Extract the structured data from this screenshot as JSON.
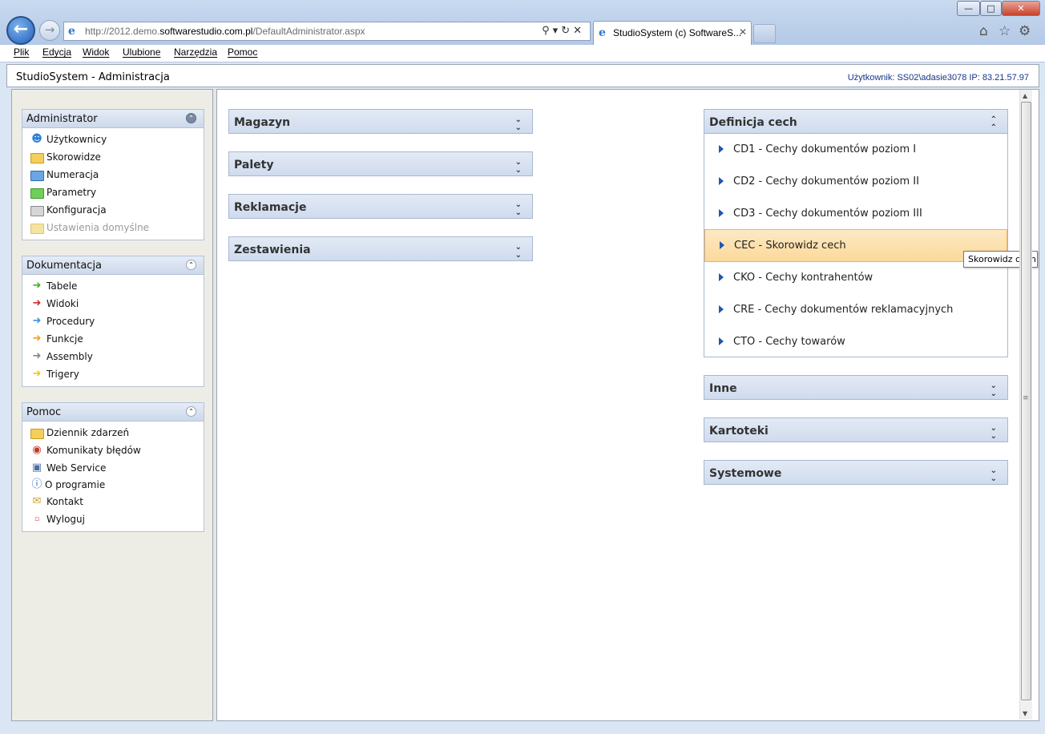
{
  "browser": {
    "url_grey": "http://2012.demo.",
    "url_domain": "softwarestudio.com.pl",
    "url_path": "/DefaultAdministrator.aspx",
    "tab_title": "StudioSystem (c) SoftwareS...",
    "window_controls": [
      "minimize-icon",
      "maximize-icon",
      "close-icon"
    ],
    "toolbar_icons": [
      "home-icon",
      "favorites-star-icon",
      "gear-icon"
    ]
  },
  "menubar": [
    "Plik",
    "Edycja",
    "Widok",
    "Ulubione",
    "Narzędzia",
    "Pomoc"
  ],
  "app": {
    "title": "StudioSystem - Administracja",
    "user_info": "Użytkownik: SS02\\adasie3078 IP: 83.21.57.97"
  },
  "left_panels": [
    {
      "title": "Administrator",
      "items": [
        {
          "label": "Użytkownicy",
          "icon": "users-icon",
          "disabled": false
        },
        {
          "label": "Skorowidze",
          "icon": "folder-yellow-icon",
          "disabled": false
        },
        {
          "label": "Numeracja",
          "icon": "folder-blue-icon",
          "disabled": false
        },
        {
          "label": "Parametry",
          "icon": "folder-green-icon",
          "disabled": false
        },
        {
          "label": "Konfiguracja",
          "icon": "folder-grey-icon",
          "disabled": false
        },
        {
          "label": "Ustawienia domyślne",
          "icon": "folder-yellow-icon",
          "disabled": true
        }
      ]
    },
    {
      "title": "Dokumentacja",
      "items": [
        {
          "label": "Tabele",
          "icon": "arrow-green-icon"
        },
        {
          "label": "Widoki",
          "icon": "arrow-red-icon"
        },
        {
          "label": "Procedury",
          "icon": "arrow-blue-icon"
        },
        {
          "label": "Funkcje",
          "icon": "arrow-orange-icon"
        },
        {
          "label": "Assembly",
          "icon": "arrow-grey-icon"
        },
        {
          "label": "Trigery",
          "icon": "arrow-yellow-icon"
        }
      ]
    },
    {
      "title": "Pomoc",
      "items": [
        {
          "label": "Dziennik zdarzeń",
          "icon": "event-log-icon"
        },
        {
          "label": "Komunikaty błędów",
          "icon": "error-stop-icon"
        },
        {
          "label": "Web Service",
          "icon": "web-service-icon"
        },
        {
          "label": "O programie",
          "icon": "info-icon"
        },
        {
          "label": "Kontakt",
          "icon": "envelope-icon"
        },
        {
          "label": "Wyloguj",
          "icon": "logout-icon"
        }
      ]
    }
  ],
  "main_left_sections": [
    "Magazyn",
    "Palety",
    "Reklamacje",
    "Zestawienia"
  ],
  "definicja_cech": {
    "title": "Definicja cech",
    "items": [
      "CD1 - Cechy dokumentów poziom I",
      "CD2 - Cechy dokumentów poziom II",
      "CD3 - Cechy dokumentów poziom III",
      "CEC - Skorowidz cech",
      "CKO - Cechy kontrahentów",
      "CRE - Cechy dokumentów reklamacyjnych",
      "CTO - Cechy towarów"
    ],
    "selected_index": 3
  },
  "main_right_sections": [
    "Inne",
    "Kartoteki",
    "Systemowe"
  ],
  "tooltip": "Skorowidz cech"
}
